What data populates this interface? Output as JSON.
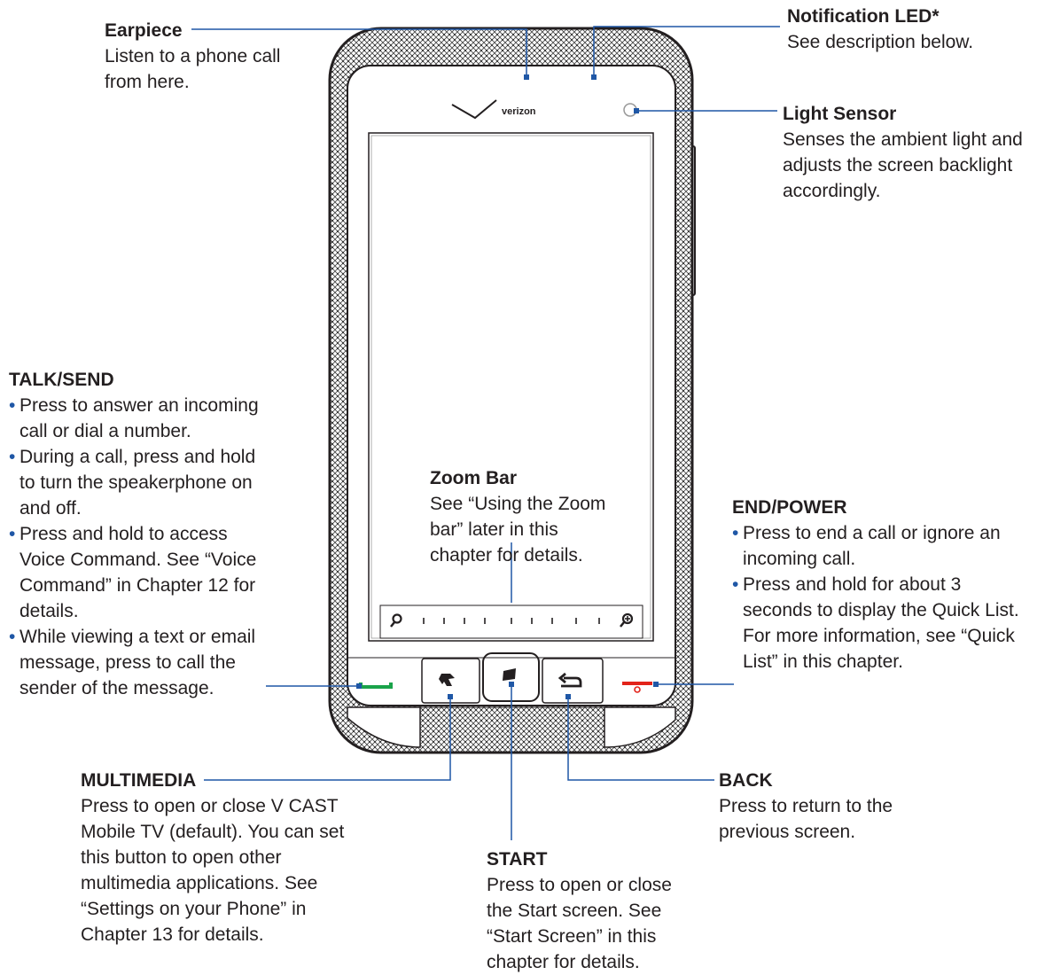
{
  "phone": {
    "brand": "verizon"
  },
  "labels": {
    "earpiece": {
      "title": "Earpiece",
      "desc": "Listen to a phone call from here."
    },
    "notification_led": {
      "title": "Notification LED*",
      "desc": "See description below."
    },
    "light_sensor": {
      "title": "Light Sensor",
      "desc": "Senses the ambient light and adjusts the screen backlight accordingly."
    },
    "talk_send": {
      "title": "TALK/SEND",
      "bullets": [
        "Press to answer an incoming call or dial a number.",
        "During a call, press and hold to turn the speakerphone on and off.",
        "Press and hold to access Voice Command. See “Voice Command” in Chapter 12 for details.",
        "While viewing a text or email message, press to call the sender of the message."
      ]
    },
    "zoom_bar": {
      "title": "Zoom Bar",
      "desc": "See “Using the Zoom bar” later in this chapter for details."
    },
    "end_power": {
      "title": "END/POWER",
      "bullets": [
        "Press to end a call or ignore an incoming call.",
        "Press and hold for about 3 seconds to display the Quick List. For more information, see “Quick List” in this chapter."
      ]
    },
    "multimedia": {
      "title": "MULTIMEDIA",
      "desc": "Press to open or close V CAST Mobile TV (default). You can set this button to open other multimedia applications. See “Settings on your Phone” in Chapter 13 for details."
    },
    "back": {
      "title": "BACK",
      "desc": "Press to return to the previous screen."
    },
    "start": {
      "title": "START",
      "desc": "Press to open or close the Start screen. See “Start Screen” in this chapter for details."
    }
  },
  "colors": {
    "leader_line": "#1f57a6",
    "talk_button": "#1aa34a",
    "end_button": "#e2231a",
    "body_outline": "#231f20"
  },
  "icons": {
    "talk": "phone-pickup-icon",
    "multimedia": "multimedia-icon",
    "start": "windows-start-icon",
    "back": "back-arrow-icon",
    "end": "phone-hangup-icon",
    "zoom_out": "zoom-out-icon",
    "zoom_in": "zoom-in-icon"
  }
}
